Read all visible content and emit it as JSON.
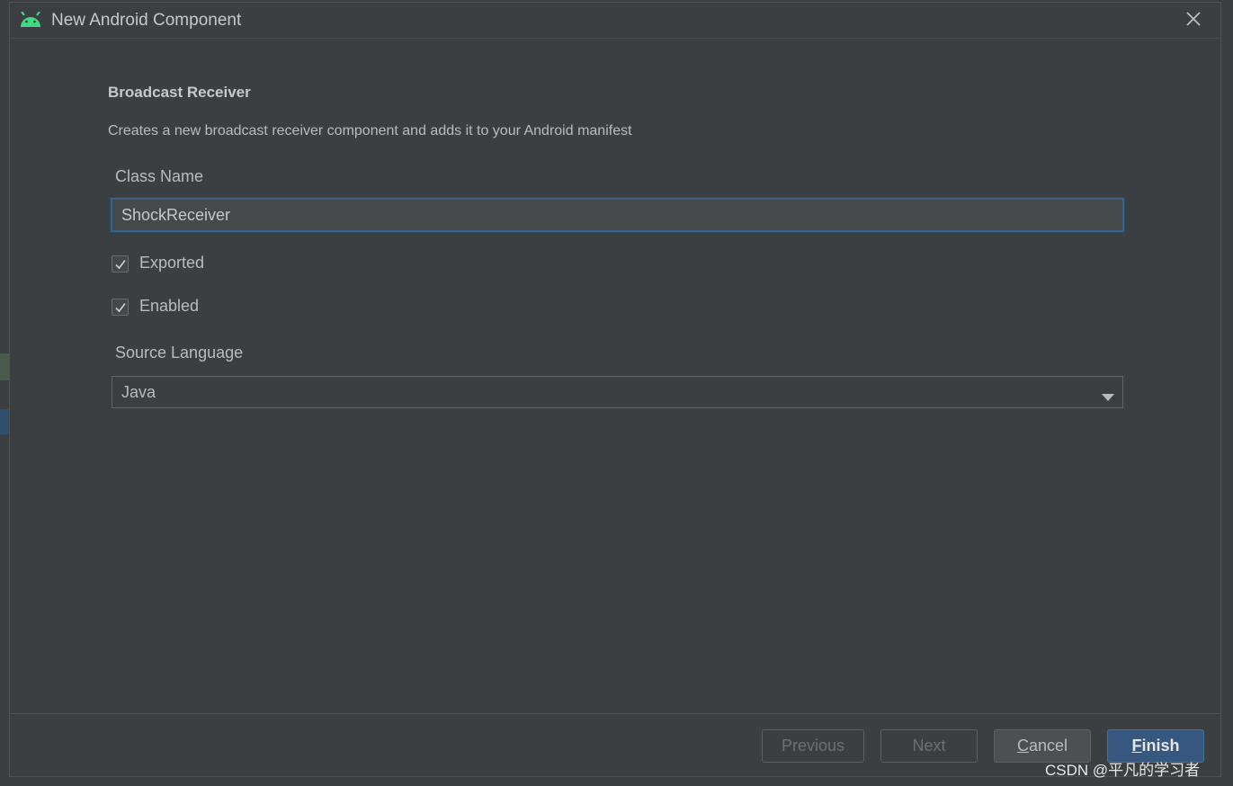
{
  "dialog": {
    "title": "New Android Component",
    "icon": "android-icon",
    "close_icon": "close-icon"
  },
  "form": {
    "heading": "Broadcast Receiver",
    "description": "Creates a new broadcast receiver component and adds it to your Android manifest",
    "class_name_label": "Class Name",
    "class_name_value": "ShockReceiver",
    "exported_label": "Exported",
    "exported_checked": true,
    "enabled_label": "Enabled",
    "enabled_checked": true,
    "source_language_label": "Source Language",
    "source_language_value": "Java"
  },
  "buttons": {
    "previous": "Previous",
    "next": "Next",
    "cancel_mnemonic": "C",
    "cancel_rest": "ancel",
    "finish_mnemonic": "F",
    "finish_rest": "inish"
  },
  "watermark": "CSDN @平凡的学习者",
  "colors": {
    "background": "#3c3f41",
    "accent": "#365880",
    "android_green": "#3ddc84",
    "focus_border": "#3d6185"
  }
}
